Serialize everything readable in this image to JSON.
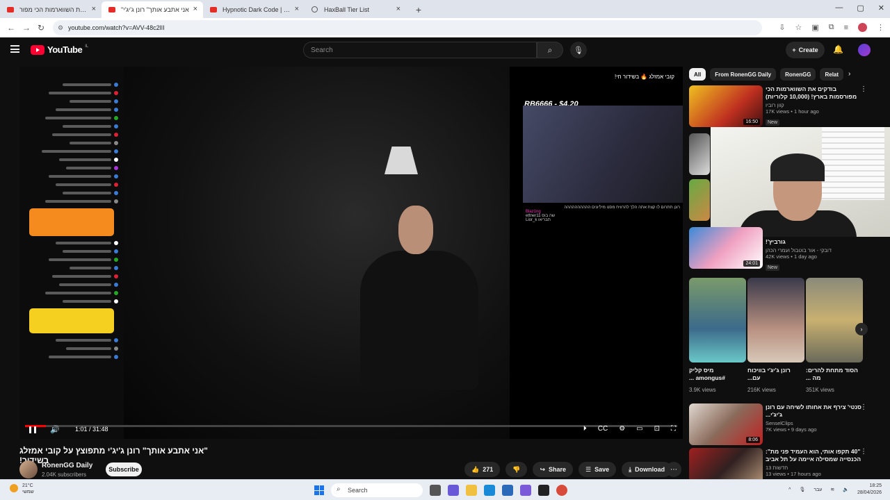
{
  "browser": {
    "tabs": [
      {
        "label": "בודקים את השווארמות הכי מפור",
        "active": false
      },
      {
        "label": "\"אני אתבע אותך\" רונן ג'יג'י",
        "active": true
      },
      {
        "label": "Hypnotic Dark Code | Futuristic",
        "active": false
      },
      {
        "label": "HaxBall Tier List",
        "active": false
      }
    ],
    "url": "youtube.com/watch?v=AVV-48c2lII"
  },
  "header": {
    "logo": "YouTube",
    "country": "IL",
    "search_placeholder": "Search",
    "create_label": "Create"
  },
  "player": {
    "time": "1:01 / 31:48",
    "progress_fraction": 0.032,
    "overlay_text": "RB6666 - $4.20",
    "overlay_title": "קובי אמזלג 🔥 בשידור חי!",
    "inset_chat": [
      "רונן תתרום לו קצת אתה הלך להרוויח מסנו מיליונים הההההההההה",
      "Blaz1ng",
      "ettner11 שה בוס",
      "Lior_k תבריאו"
    ]
  },
  "video": {
    "title": "\"אני אתבע אותך\" רונן ג'יג'י מתפוצץ על קובי אמזלג בשידור!",
    "channel": "RonenGG Daily",
    "subscribers": "2.04K subscribers",
    "subscribe_label": "Subscribe",
    "likes": "271",
    "share_label": "Share",
    "save_label": "Save",
    "download_label": "Download"
  },
  "chips": [
    "All",
    "From RonenGG Daily",
    "RonenGG",
    "Relat"
  ],
  "recommendations": [
    {
      "title": "בודקים את השווארמות הכי מפורסמות בארץ! (10,000 קלוריות)",
      "channel": "קוון רוביו",
      "views": "17K views",
      "age": "1 hour ago",
      "duration": "16:50",
      "badge": "New"
    },
    {
      "title": "גורביץ'!",
      "channel": "דובקי - אור בוטבול ועמרי הכהן",
      "views": "42K views",
      "age": "1 day ago",
      "duration": "24:01",
      "badge": "New"
    },
    {
      "title": "סנטי' צירף את אחותו לשיחה עם רונן ג'יג'י...",
      "channel": "SenselClips",
      "views": "7K views",
      "age": "9 days ago",
      "duration": "8:06",
      "badge": ""
    },
    {
      "title": "\"40 תקפו אותי, הוא העמיד פני מת\": הכנסייה שמסילה איימה על תל אביב",
      "channel": "חדשות 13",
      "views": "13 views",
      "age": "17 hours ago",
      "duration": "",
      "badge": ""
    }
  ],
  "shorts": [
    {
      "title": "מיס קליק #amongus ...",
      "views": "3.9K views"
    },
    {
      "title": "רונן ג'יג'י בוויכוח עם...",
      "views": "216K views"
    },
    {
      "title": "הסוד מתחת להרים: מה ...",
      "views": "351K views"
    }
  ],
  "taskbar": {
    "temp": "21°C",
    "weather": "שמשי",
    "search": "Search",
    "lang": "עבר",
    "time": "18:25",
    "date": "28/04/2026"
  },
  "colors": {
    "accent": "#ff0000",
    "bg": "#0f0f0f",
    "chip_active": "#f1f1f1"
  }
}
